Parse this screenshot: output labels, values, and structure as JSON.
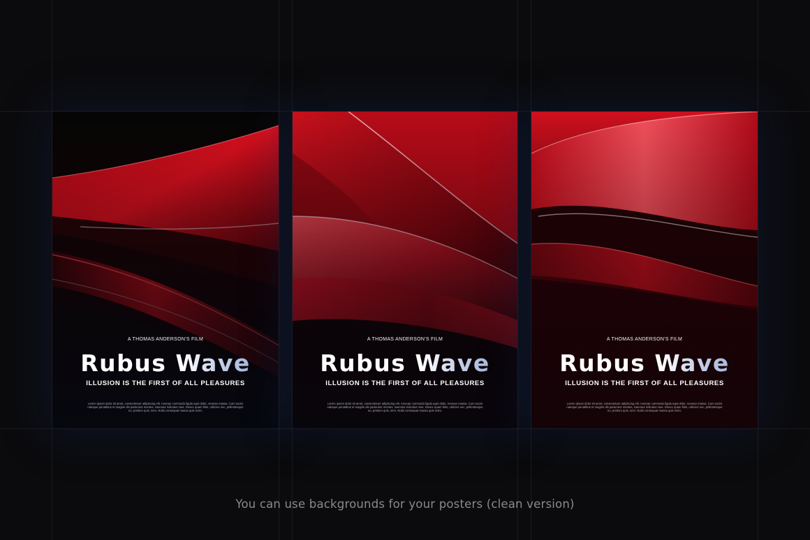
{
  "posters": [
    {
      "credit": "A THOMAS ANDERSON'S FILM",
      "title": "Rubus Wave",
      "tagline": "ILLUSION IS THE FIRST OF ALL PLEASURES",
      "body": "Lorem ipsum dolor sit amet, consectetuer adipiscing elit. Aenean commodo ligula eget dolor. Aenean massa. Cum sociis natoque penatibus et magnis dis parturient montes, nascetur ridiculus mus. Donec quam felis, ultricies nec, pellentesque eu, pretium quis, sem. Nulla consequat massa quis enim."
    },
    {
      "credit": "A THOMAS ANDERSON'S FILM",
      "title": "Rubus Wave",
      "tagline": "ILLUSION IS THE FIRST OF ALL PLEASURES",
      "body": "Lorem ipsum dolor sit amet, consectetuer adipiscing elit. Aenean commodo ligula eget dolor. Aenean massa. Cum sociis natoque penatibus et magnis dis parturient montes, nascetur ridiculus mus. Donec quam felis, ultricies nec, pellentesque eu, pretium quis, sem. Nulla consequat massa quis enim."
    },
    {
      "credit": "A THOMAS ANDERSON'S FILM",
      "title": "Rubus Wave",
      "tagline": "ILLUSION IS THE FIRST OF ALL PLEASURES",
      "body": "Lorem ipsum dolor sit amet, consectetuer adipiscing elit. Aenean commodo ligula eget dolor. Aenean massa. Cum sociis natoque penatibus et magnis dis parturient montes, nascetur ridiculus mus. Donec quam felis, ultricies nec, pellentesque eu, pretium quis, sem. Nulla consequat massa quis enim."
    }
  ],
  "caption": "You can use backgrounds for your posters (clean version)",
  "colors": {
    "background": "#0b0b0d",
    "accent_red": "#d0101e",
    "title_gradient_end": "#8fa4d0"
  }
}
